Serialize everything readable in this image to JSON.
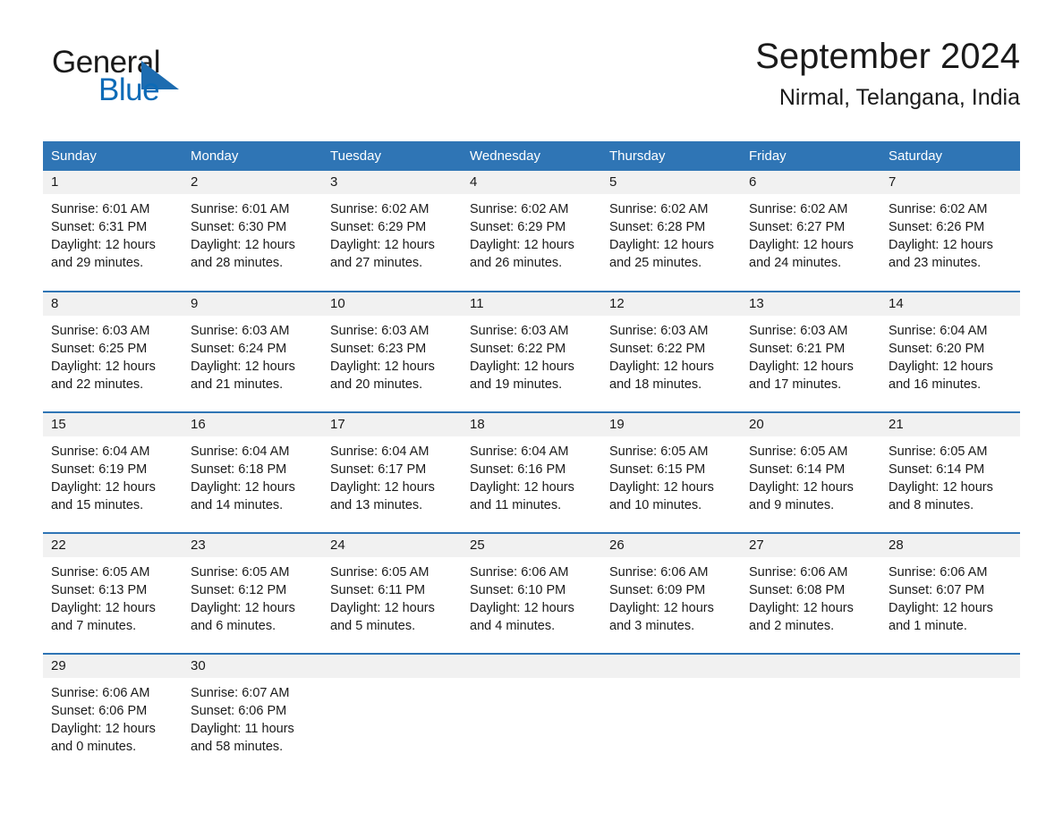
{
  "brand": {
    "name_part1": "General",
    "name_part2": "Blue",
    "accent_color": "#1d6cb0"
  },
  "header": {
    "month_title": "September 2024",
    "location": "Nirmal, Telangana, India"
  },
  "theme": {
    "header_row_bg": "#2f75b5",
    "daynum_bg": "#f1f1f1",
    "row_divider": "#2f75b5",
    "text": "#1a1a1a"
  },
  "weekdays": [
    "Sunday",
    "Monday",
    "Tuesday",
    "Wednesday",
    "Thursday",
    "Friday",
    "Saturday"
  ],
  "labels": {
    "sunrise_prefix": "Sunrise:",
    "sunset_prefix": "Sunset:",
    "daylight_prefix": "Daylight:"
  },
  "weeks": [
    [
      {
        "day": "1",
        "sunrise": "Sunrise: 6:01 AM",
        "sunset": "Sunset: 6:31 PM",
        "daylight": "Daylight: 12 hours and 29 minutes."
      },
      {
        "day": "2",
        "sunrise": "Sunrise: 6:01 AM",
        "sunset": "Sunset: 6:30 PM",
        "daylight": "Daylight: 12 hours and 28 minutes."
      },
      {
        "day": "3",
        "sunrise": "Sunrise: 6:02 AM",
        "sunset": "Sunset: 6:29 PM",
        "daylight": "Daylight: 12 hours and 27 minutes."
      },
      {
        "day": "4",
        "sunrise": "Sunrise: 6:02 AM",
        "sunset": "Sunset: 6:29 PM",
        "daylight": "Daylight: 12 hours and 26 minutes."
      },
      {
        "day": "5",
        "sunrise": "Sunrise: 6:02 AM",
        "sunset": "Sunset: 6:28 PM",
        "daylight": "Daylight: 12 hours and 25 minutes."
      },
      {
        "day": "6",
        "sunrise": "Sunrise: 6:02 AM",
        "sunset": "Sunset: 6:27 PM",
        "daylight": "Daylight: 12 hours and 24 minutes."
      },
      {
        "day": "7",
        "sunrise": "Sunrise: 6:02 AM",
        "sunset": "Sunset: 6:26 PM",
        "daylight": "Daylight: 12 hours and 23 minutes."
      }
    ],
    [
      {
        "day": "8",
        "sunrise": "Sunrise: 6:03 AM",
        "sunset": "Sunset: 6:25 PM",
        "daylight": "Daylight: 12 hours and 22 minutes."
      },
      {
        "day": "9",
        "sunrise": "Sunrise: 6:03 AM",
        "sunset": "Sunset: 6:24 PM",
        "daylight": "Daylight: 12 hours and 21 minutes."
      },
      {
        "day": "10",
        "sunrise": "Sunrise: 6:03 AM",
        "sunset": "Sunset: 6:23 PM",
        "daylight": "Daylight: 12 hours and 20 minutes."
      },
      {
        "day": "11",
        "sunrise": "Sunrise: 6:03 AM",
        "sunset": "Sunset: 6:22 PM",
        "daylight": "Daylight: 12 hours and 19 minutes."
      },
      {
        "day": "12",
        "sunrise": "Sunrise: 6:03 AM",
        "sunset": "Sunset: 6:22 PM",
        "daylight": "Daylight: 12 hours and 18 minutes."
      },
      {
        "day": "13",
        "sunrise": "Sunrise: 6:03 AM",
        "sunset": "Sunset: 6:21 PM",
        "daylight": "Daylight: 12 hours and 17 minutes."
      },
      {
        "day": "14",
        "sunrise": "Sunrise: 6:04 AM",
        "sunset": "Sunset: 6:20 PM",
        "daylight": "Daylight: 12 hours and 16 minutes."
      }
    ],
    [
      {
        "day": "15",
        "sunrise": "Sunrise: 6:04 AM",
        "sunset": "Sunset: 6:19 PM",
        "daylight": "Daylight: 12 hours and 15 minutes."
      },
      {
        "day": "16",
        "sunrise": "Sunrise: 6:04 AM",
        "sunset": "Sunset: 6:18 PM",
        "daylight": "Daylight: 12 hours and 14 minutes."
      },
      {
        "day": "17",
        "sunrise": "Sunrise: 6:04 AM",
        "sunset": "Sunset: 6:17 PM",
        "daylight": "Daylight: 12 hours and 13 minutes."
      },
      {
        "day": "18",
        "sunrise": "Sunrise: 6:04 AM",
        "sunset": "Sunset: 6:16 PM",
        "daylight": "Daylight: 12 hours and 11 minutes."
      },
      {
        "day": "19",
        "sunrise": "Sunrise: 6:05 AM",
        "sunset": "Sunset: 6:15 PM",
        "daylight": "Daylight: 12 hours and 10 minutes."
      },
      {
        "day": "20",
        "sunrise": "Sunrise: 6:05 AM",
        "sunset": "Sunset: 6:14 PM",
        "daylight": "Daylight: 12 hours and 9 minutes."
      },
      {
        "day": "21",
        "sunrise": "Sunrise: 6:05 AM",
        "sunset": "Sunset: 6:14 PM",
        "daylight": "Daylight: 12 hours and 8 minutes."
      }
    ],
    [
      {
        "day": "22",
        "sunrise": "Sunrise: 6:05 AM",
        "sunset": "Sunset: 6:13 PM",
        "daylight": "Daylight: 12 hours and 7 minutes."
      },
      {
        "day": "23",
        "sunrise": "Sunrise: 6:05 AM",
        "sunset": "Sunset: 6:12 PM",
        "daylight": "Daylight: 12 hours and 6 minutes."
      },
      {
        "day": "24",
        "sunrise": "Sunrise: 6:05 AM",
        "sunset": "Sunset: 6:11 PM",
        "daylight": "Daylight: 12 hours and 5 minutes."
      },
      {
        "day": "25",
        "sunrise": "Sunrise: 6:06 AM",
        "sunset": "Sunset: 6:10 PM",
        "daylight": "Daylight: 12 hours and 4 minutes."
      },
      {
        "day": "26",
        "sunrise": "Sunrise: 6:06 AM",
        "sunset": "Sunset: 6:09 PM",
        "daylight": "Daylight: 12 hours and 3 minutes."
      },
      {
        "day": "27",
        "sunrise": "Sunrise: 6:06 AM",
        "sunset": "Sunset: 6:08 PM",
        "daylight": "Daylight: 12 hours and 2 minutes."
      },
      {
        "day": "28",
        "sunrise": "Sunrise: 6:06 AM",
        "sunset": "Sunset: 6:07 PM",
        "daylight": "Daylight: 12 hours and 1 minute."
      }
    ],
    [
      {
        "day": "29",
        "sunrise": "Sunrise: 6:06 AM",
        "sunset": "Sunset: 6:06 PM",
        "daylight": "Daylight: 12 hours and 0 minutes."
      },
      {
        "day": "30",
        "sunrise": "Sunrise: 6:07 AM",
        "sunset": "Sunset: 6:06 PM",
        "daylight": "Daylight: 11 hours and 58 minutes."
      },
      null,
      null,
      null,
      null,
      null
    ]
  ]
}
